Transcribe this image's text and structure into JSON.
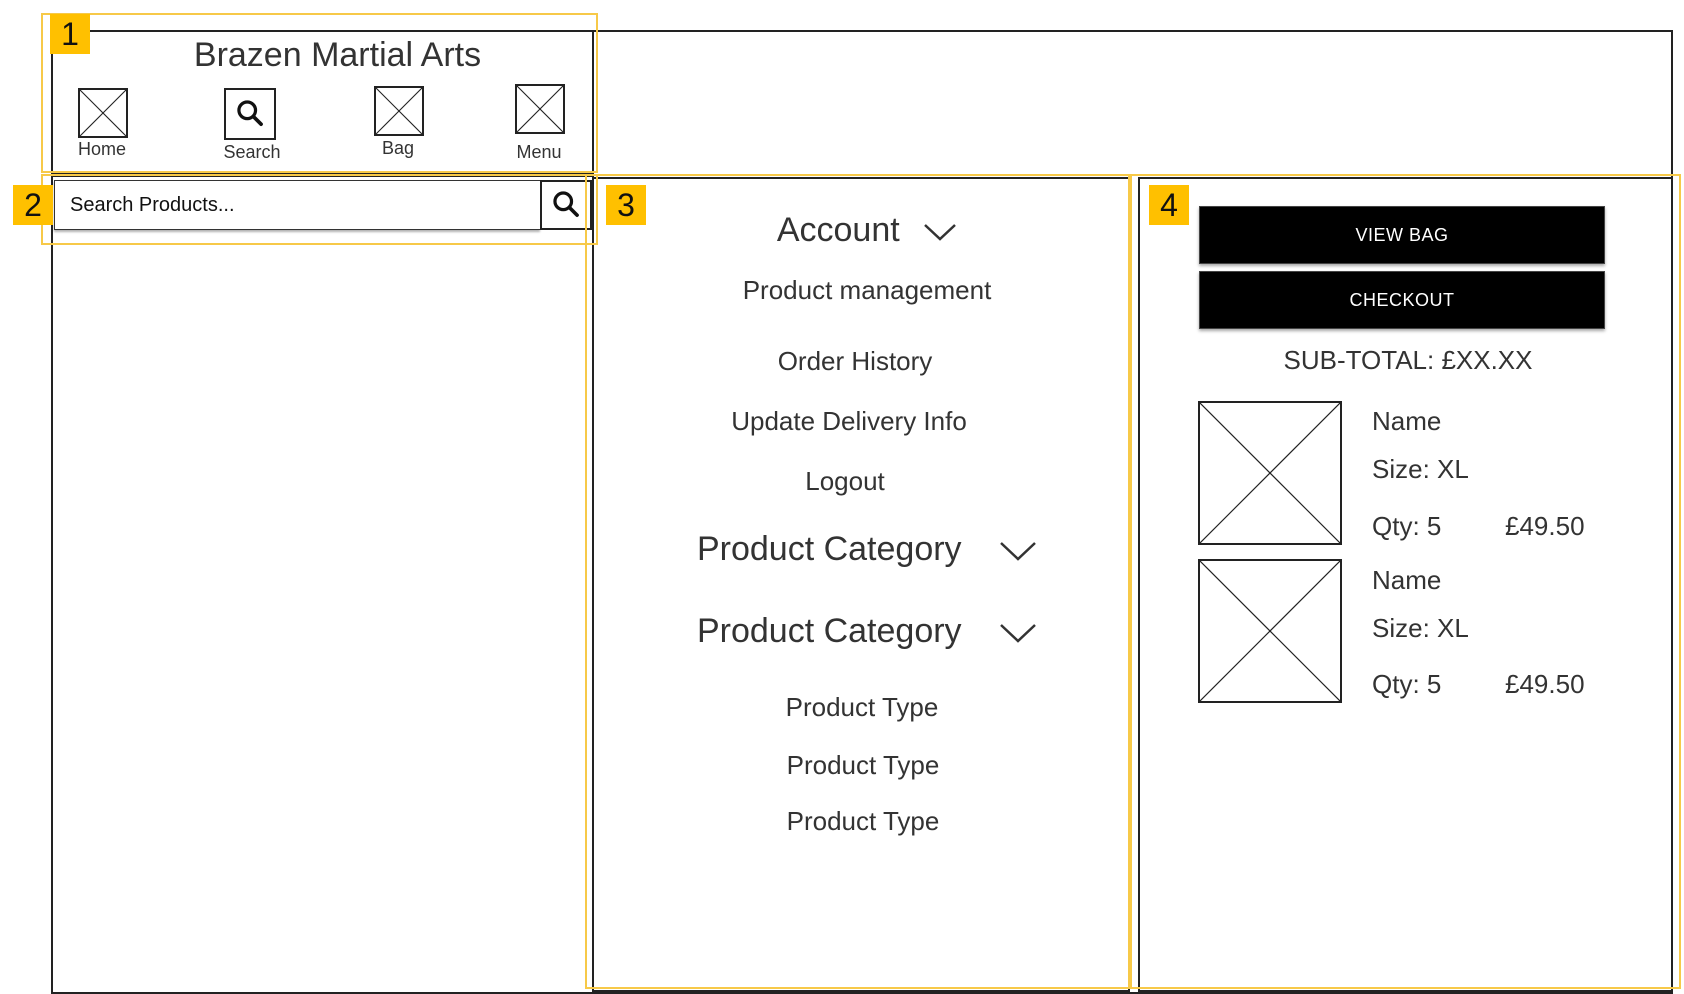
{
  "brand": {
    "title": "Brazen Martial Arts"
  },
  "nav": {
    "home_label": "Home",
    "search_label": "Search",
    "bag_label": "Bag",
    "menu_label": "Menu"
  },
  "search": {
    "placeholder": "Search Products..."
  },
  "annotations": [
    "1",
    "2",
    "3",
    "4"
  ],
  "menu": {
    "account_heading": "Account",
    "account_items": [
      "Product management",
      "Order History",
      "Update Delivery Info",
      "Logout"
    ],
    "category_1": "Product Category",
    "category_2": "Product Category",
    "product_types": [
      "Product Type",
      "Product Type",
      "Product Type"
    ]
  },
  "bag": {
    "view_bag_label": "VIEW BAG",
    "checkout_label": "CHECKOUT",
    "subtotal": "SUB-TOTAL: £XX.XX",
    "items": [
      {
        "name": "Name",
        "size": "Size: XL",
        "qty": "Qty: 5",
        "price": "£49.50"
      },
      {
        "name": "Name",
        "size": "Size: XL",
        "qty": "Qty: 5",
        "price": "£49.50"
      }
    ]
  },
  "colors": {
    "highlight": "#ffc000",
    "button": "#000000",
    "frame": "#222222"
  }
}
